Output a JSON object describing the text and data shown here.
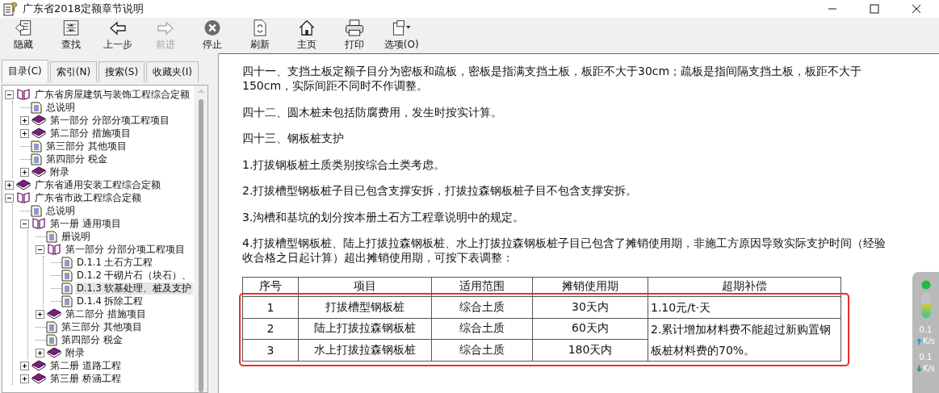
{
  "window": {
    "title": "广东省2018定额章节说明"
  },
  "toolbar": [
    {
      "label": "隐藏",
      "kind": "hide",
      "disabled": false
    },
    {
      "label": "查找",
      "kind": "find",
      "disabled": false
    },
    {
      "label": "上一步",
      "kind": "back",
      "disabled": false
    },
    {
      "label": "前进",
      "kind": "forward",
      "disabled": true
    },
    {
      "label": "停止",
      "kind": "stop",
      "disabled": false
    },
    {
      "label": "刷新",
      "kind": "refresh",
      "disabled": false
    },
    {
      "label": "主页",
      "kind": "home",
      "disabled": false
    },
    {
      "label": "打印",
      "kind": "print",
      "disabled": false
    },
    {
      "label": "选项(O)",
      "kind": "options",
      "disabled": false
    }
  ],
  "tabs": [
    {
      "label": "目录(C)",
      "selected": true
    },
    {
      "label": "索引(N)",
      "selected": false
    },
    {
      "label": "搜索(S)",
      "selected": false
    },
    {
      "label": "收藏夹(I)",
      "selected": false
    }
  ],
  "tree": [
    {
      "label": "广东省房屋建筑与装饰工程综合定额",
      "kind": "book",
      "expanded": true,
      "selected": false,
      "children": [
        {
          "label": "总说明",
          "kind": "page",
          "selected": false
        },
        {
          "label": "第一部分 分部分项工程项目",
          "kind": "book",
          "expanded": false,
          "selected": false
        },
        {
          "label": "第二部分 措施项目",
          "kind": "book",
          "expanded": false,
          "selected": false
        },
        {
          "label": "第三部分 其他项目",
          "kind": "page",
          "selected": false
        },
        {
          "label": "第四部分 税金",
          "kind": "page",
          "selected": false
        },
        {
          "label": "附录",
          "kind": "book",
          "expanded": false,
          "selected": false
        }
      ]
    },
    {
      "label": "广东省通用安装工程综合定额",
      "kind": "book",
      "expanded": false,
      "selected": false
    },
    {
      "label": "广东省市政工程综合定额",
      "kind": "book",
      "expanded": true,
      "selected": false,
      "children": [
        {
          "label": "总说明",
          "kind": "page",
          "selected": false
        },
        {
          "label": "第一册 通用项目",
          "kind": "book",
          "expanded": true,
          "selected": false,
          "children": [
            {
              "label": "册说明",
              "kind": "page",
              "selected": false
            },
            {
              "label": "第一部分 分部分项工程项目",
              "kind": "book",
              "expanded": true,
              "selected": false,
              "children": [
                {
                  "label": "D.1.1 土石方工程",
                  "kind": "page",
                  "selected": false
                },
                {
                  "label": "D.1.2 干砌片石（块石）、",
                  "kind": "page",
                  "selected": false
                },
                {
                  "label": "D.1.3 软基处理、桩及支护",
                  "kind": "page",
                  "selected": true
                },
                {
                  "label": "D.1.4 拆除工程",
                  "kind": "page",
                  "selected": false
                }
              ]
            },
            {
              "label": "第二部分 措施项目",
              "kind": "book",
              "expanded": false,
              "selected": false
            },
            {
              "label": "第三部分 其他项目",
              "kind": "page",
              "selected": false
            },
            {
              "label": "第四部分 税金",
              "kind": "page",
              "selected": false
            },
            {
              "label": "附录",
              "kind": "book",
              "expanded": false,
              "selected": false
            }
          ]
        },
        {
          "label": "第二册 道路工程",
          "kind": "book",
          "expanded": false,
          "selected": false
        },
        {
          "label": "第三册 桥涵工程",
          "kind": "book",
          "expanded": false,
          "selected": false
        }
      ]
    }
  ],
  "content": {
    "paragraphs": [
      "四十一、支挡土板定额子目分为密板和疏板，密板是指满支挡土板，板距不大于30cm；疏板是指间隔支挡土板，板距不大于150cm，实际间距不同时不作调整。",
      "四十二、圆木桩未包括防腐费用，发生时按实计算。",
      "四十三、钢板桩支护",
      "1.打拔钢板桩土质类别按综合土类考虑。",
      "2.打拔槽型钢板桩子目已包含支撑安拆，打拔拉森钢板桩子目不包含支撑安拆。",
      "3.沟槽和基坑的划分按本册土石方工程章说明中的规定。",
      "4.打拔槽型钢板桩、陆上打拔拉森钢板桩、水上打拔拉森钢板桩子目已包含了摊销使用期，非施工方原因导致实际支护时间（经验收合格之日起计算）超出摊销使用期，可按下表调整："
    ],
    "table": {
      "columns": [
        "序号",
        "项目",
        "适用范围",
        "摊销使用期",
        "超期补偿"
      ],
      "rows": [
        [
          "1",
          "打拔槽型钢板桩",
          "综合土质",
          "30天内"
        ],
        [
          "2",
          "陆上打拔拉森钢板桩",
          "综合土质",
          "60天内"
        ],
        [
          "3",
          "水上打拔拉森钢板桩",
          "综合土质",
          "180天内"
        ]
      ],
      "compensation": [
        "1.10元/t·天",
        "2.累计增加材料费不能超过新购置钢板桩材料费的70%。"
      ]
    }
  },
  "speed_widget": {
    "upload": {
      "value": "0.1",
      "unit": "K/s"
    },
    "download": {
      "value": "0.1",
      "unit": "K/s"
    }
  }
}
